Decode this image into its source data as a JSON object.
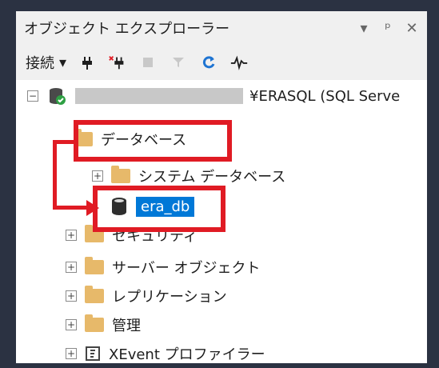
{
  "title": "オブジェクト エクスプローラー",
  "title_controls": {
    "dropdown": "▾",
    "pin": "ᵖ",
    "close": "✕"
  },
  "toolbar": {
    "connect_label": "接続",
    "dropdown_glyph": "▾"
  },
  "tree": {
    "server_label": "¥ERASQL (SQL Serve",
    "nodes": {
      "databases": "データベース",
      "system_databases": "システム データベース",
      "era_db": "era_db",
      "security": "セキュリティ",
      "server_objects": "サーバー オブジェクト",
      "replication": "レプリケーション",
      "management": "管理",
      "xevent_profiler": "XEvent プロファイラー"
    }
  },
  "colors": {
    "selection": "#0078d7",
    "annotation_red": "#e01b24",
    "folder": "#e7b96a"
  }
}
